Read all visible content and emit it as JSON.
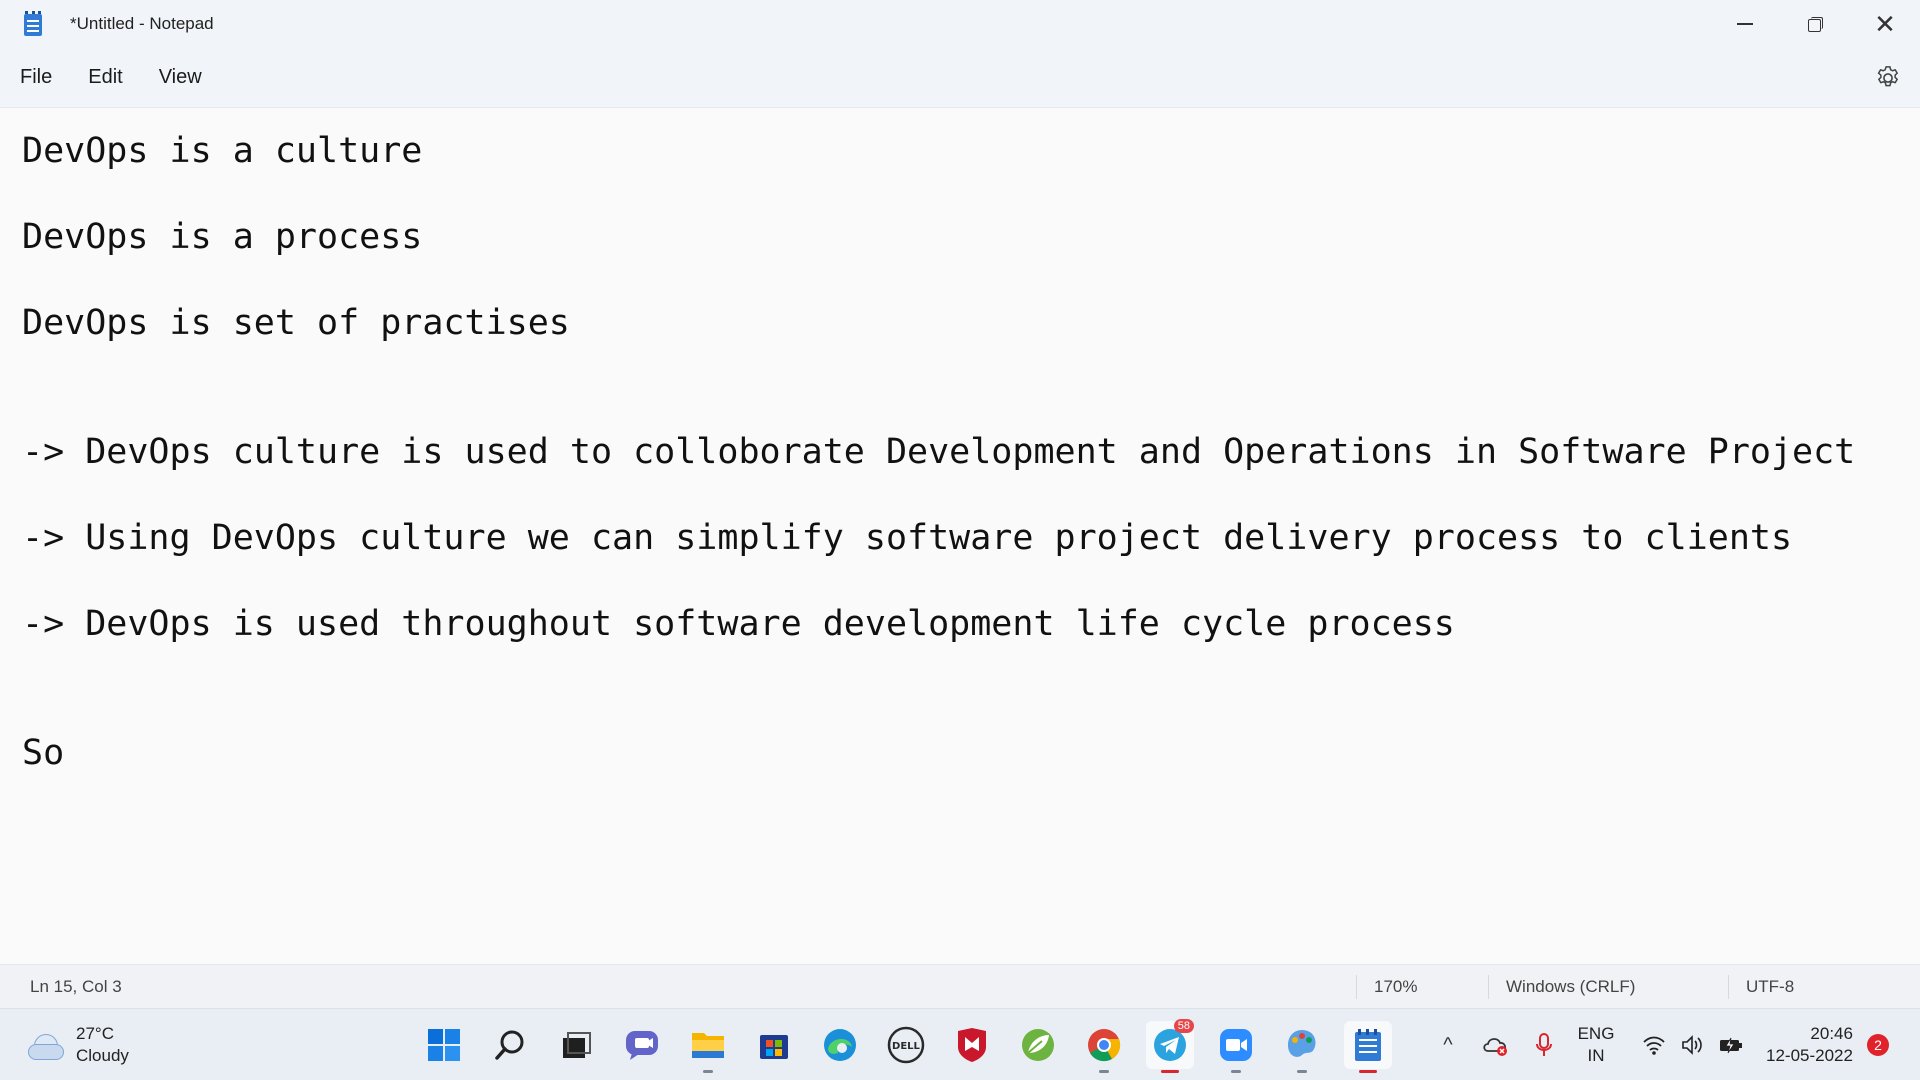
{
  "window": {
    "title": "*Untitled - Notepad",
    "controls": {
      "minimize": "minimize-icon",
      "maximize": "restore-icon",
      "close": "close-icon",
      "close_glyph": "✕"
    }
  },
  "menu": {
    "items": [
      "File",
      "Edit",
      "View"
    ],
    "settings_icon": "gear-icon"
  },
  "editor": {
    "lines": [
      "DevOps is a culture",
      "",
      "DevOps is a process",
      "",
      "DevOps is set of practises",
      "",
      "",
      "-> DevOps culture is used to colloborate Development and Operations in Software Project",
      "",
      "-> Using DevOps culture we can simplify software project delivery process to clients",
      "",
      "-> DevOps is used throughout software development life cycle process",
      "",
      "",
      "So"
    ]
  },
  "status": {
    "position": "Ln 15, Col 3",
    "zoom": "170%",
    "line_ending": "Windows (CRLF)",
    "encoding": "UTF-8"
  },
  "taskbar": {
    "weather": {
      "temp": "27°C",
      "condition": "Cloudy",
      "icon": "cloudy-icon"
    },
    "apps": [
      {
        "name": "start",
        "icon": "windows-start-icon"
      },
      {
        "name": "search",
        "icon": "search-icon"
      },
      {
        "name": "task-view",
        "icon": "task-view-icon"
      },
      {
        "name": "chat",
        "icon": "chat-icon"
      },
      {
        "name": "file-explorer",
        "icon": "folder-icon"
      },
      {
        "name": "store",
        "icon": "store-icon"
      },
      {
        "name": "edge",
        "icon": "edge-icon"
      },
      {
        "name": "dell",
        "icon": "dell-icon"
      },
      {
        "name": "mcafee",
        "icon": "mcafee-icon"
      },
      {
        "name": "spring-tool",
        "icon": "leaf-icon"
      },
      {
        "name": "chrome",
        "icon": "chrome-icon"
      },
      {
        "name": "telegram",
        "icon": "telegram-icon",
        "badge": "58"
      },
      {
        "name": "zoom",
        "icon": "zoom-camera-icon"
      },
      {
        "name": "paint",
        "icon": "paint-icon"
      },
      {
        "name": "notepad",
        "icon": "notepad-icon"
      }
    ],
    "tray": {
      "chevron": "^",
      "lang_top": "ENG",
      "lang_bottom": "IN",
      "time": "20:46",
      "date": "12-05-2022",
      "notifications": "2"
    }
  },
  "colors": {
    "accent": "#2f7bd6",
    "notification": "#e0222b"
  }
}
